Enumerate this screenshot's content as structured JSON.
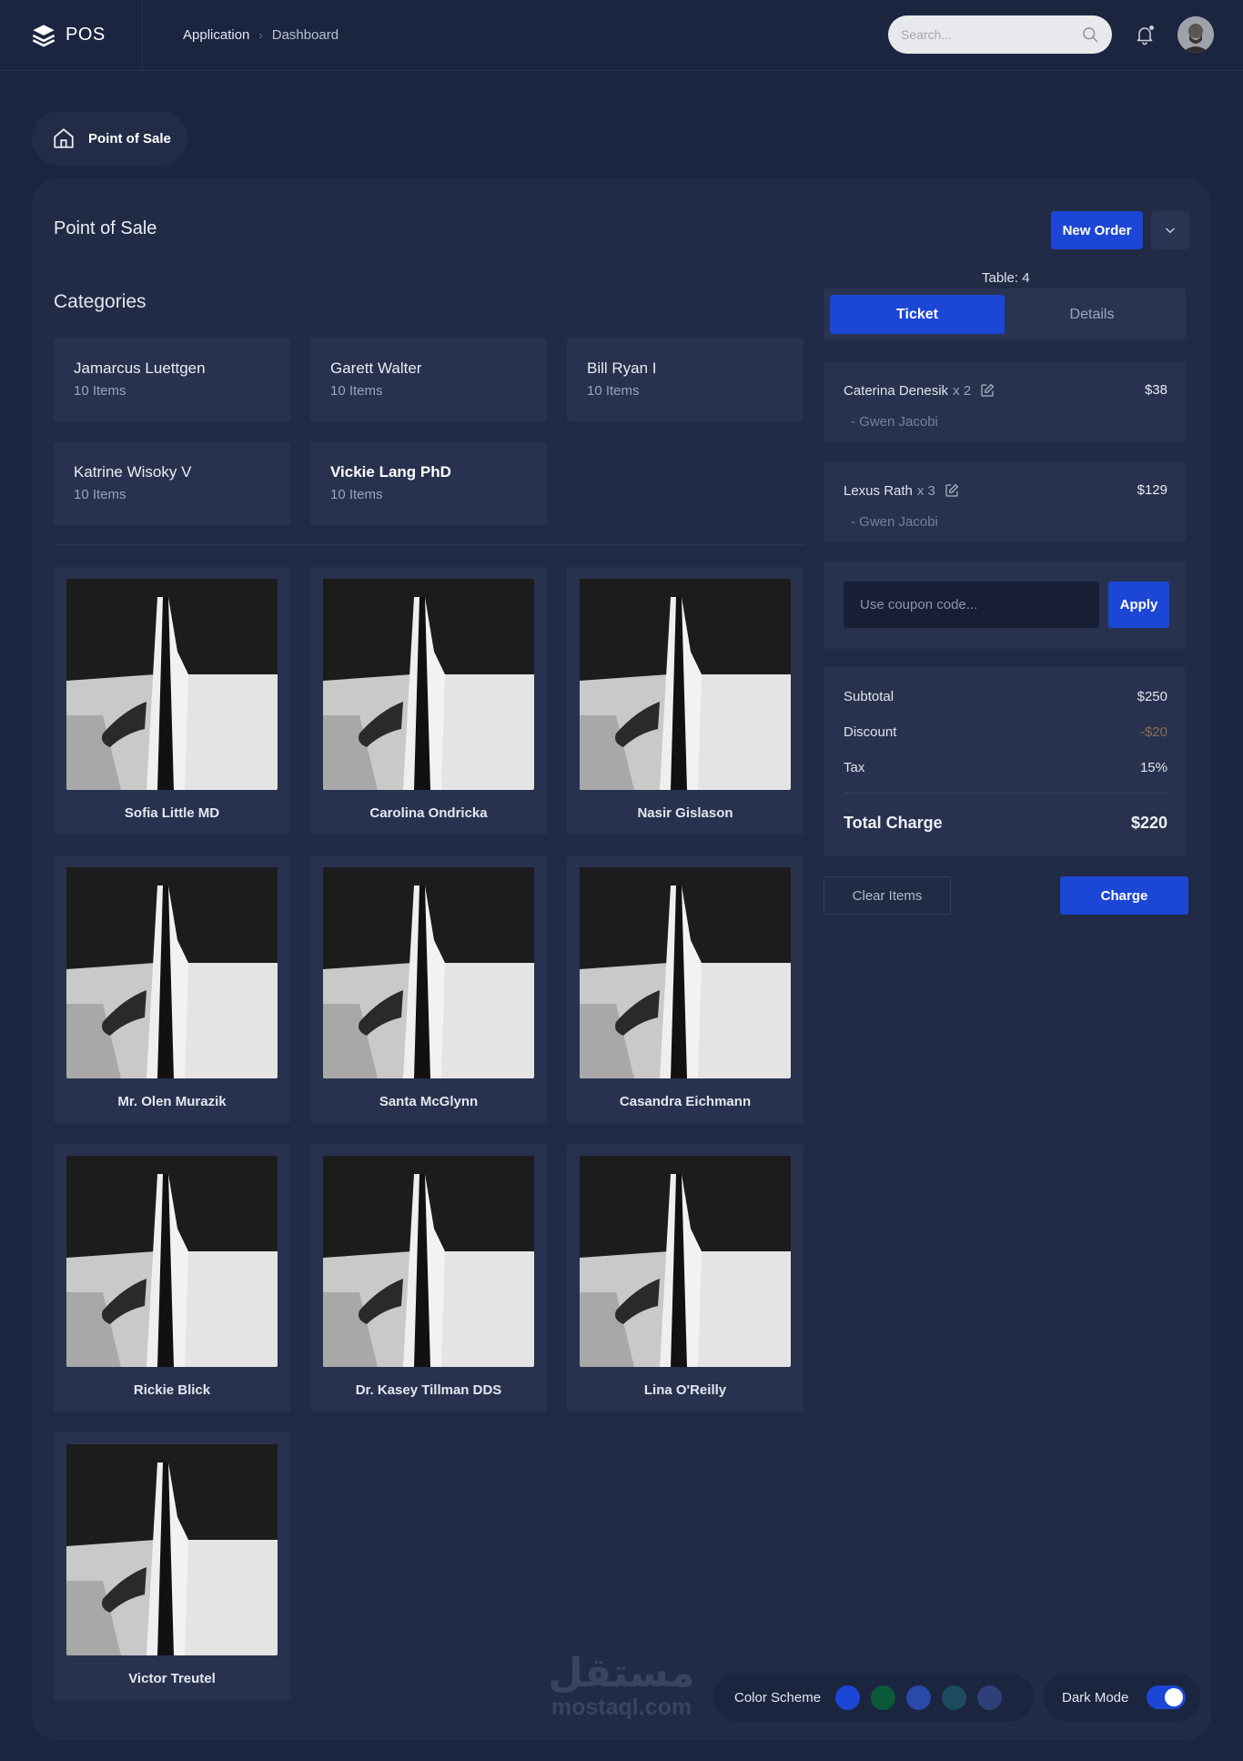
{
  "app": {
    "name": "POS"
  },
  "breadcrumb": {
    "application": "Application",
    "separator": "›",
    "dashboard": "Dashboard"
  },
  "search": {
    "placeholder": "Search..."
  },
  "page_badge": {
    "label": "Point of Sale"
  },
  "panel": {
    "title": "Point of Sale",
    "new_order_label": "New Order"
  },
  "categories": {
    "title": "Categories",
    "items": [
      {
        "name": "Jamarcus Luettgen",
        "count": "10 Items"
      },
      {
        "name": "Garett Walter",
        "count": "10 Items"
      },
      {
        "name": "Bill Ryan I",
        "count": "10 Items"
      },
      {
        "name": "Katrine Wisoky V",
        "count": "10 Items"
      },
      {
        "name": "Vickie Lang PhD",
        "count": "10 Items"
      }
    ]
  },
  "products": [
    {
      "name": "Sofia Little MD"
    },
    {
      "name": "Carolina Ondricka"
    },
    {
      "name": "Nasir Gislason"
    },
    {
      "name": "Mr. Olen Murazik"
    },
    {
      "name": "Santa McGlynn"
    },
    {
      "name": "Casandra Eichmann"
    },
    {
      "name": "Rickie Blick"
    },
    {
      "name": "Dr. Kasey Tillman DDS"
    },
    {
      "name": "Lina O'Reilly"
    },
    {
      "name": "Victor Treutel"
    }
  ],
  "order": {
    "table_label": "Table: 4",
    "tabs": {
      "ticket": "Ticket",
      "details": "Details"
    },
    "tickets": [
      {
        "name": "Caterina Denesik",
        "qty": "x 2",
        "price": "$38",
        "note": "- Gwen Jacobi"
      },
      {
        "name": "Lexus Rath",
        "qty": "x 3",
        "price": "$129",
        "note": "- Gwen Jacobi"
      }
    ],
    "coupon": {
      "placeholder": "Use coupon code...",
      "apply_label": "Apply"
    },
    "summary": {
      "subtotal_label": "Subtotal",
      "subtotal": "$250",
      "discount_label": "Discount",
      "discount": "-$20",
      "tax_label": "Tax",
      "tax": "15%",
      "total_label": "Total Charge",
      "total": "$220"
    },
    "clear_label": "Clear Items",
    "charge_label": "Charge"
  },
  "watermark": {
    "arabic": "مستقل",
    "latin": "mostaql.com"
  },
  "color_scheme": {
    "label": "Color Scheme",
    "swatches": [
      "#1c46d6",
      "#0a5a3a",
      "#2a49a8",
      "#1d4a5e",
      "#2f3f78"
    ]
  },
  "dark_mode": {
    "label": "Dark Mode",
    "enabled": true
  },
  "colors": {
    "accent": "#1c46d6",
    "background": "#1b2540",
    "panel": "#212b45",
    "card": "#28324f"
  }
}
